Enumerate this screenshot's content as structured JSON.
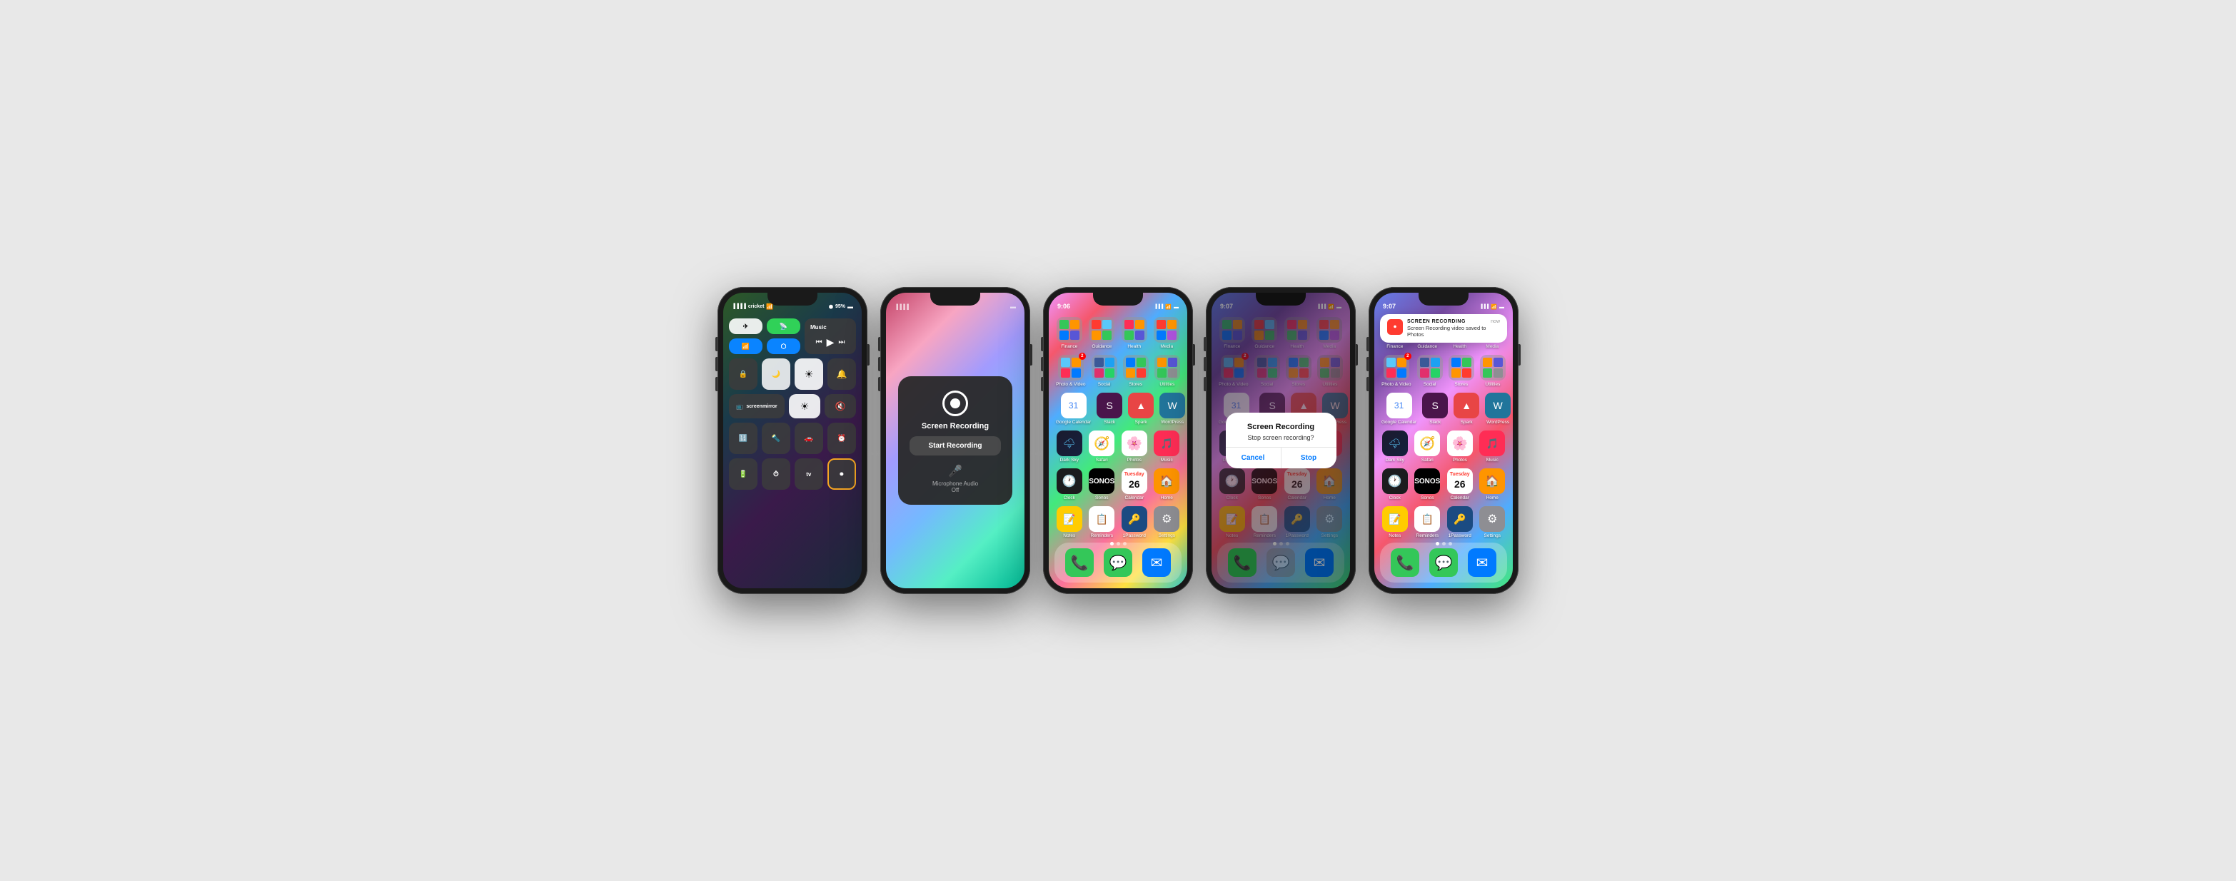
{
  "phones": [
    {
      "id": "phone1",
      "type": "control-center",
      "statusBar": {
        "time": "",
        "carrier": "cricket",
        "wifi": true,
        "battery": "95%",
        "bluetooth": true
      },
      "controlCenter": {
        "row1": [
          "airplane",
          "hotspot",
          "music_block"
        ],
        "row2": [
          "wifi",
          "bluetooth",
          "prev",
          "play",
          "next"
        ],
        "music": {
          "title": "Music"
        },
        "row3": [
          "rotation",
          "donotdisturb",
          "brightness",
          "volume"
        ],
        "row4": [
          "screenmirror",
          "brightness_slider"
        ],
        "row5": [
          "calc",
          "flashlight",
          "carplay",
          "alarm"
        ],
        "row6": [
          "battery",
          "timer",
          "appletv",
          "screenrecord"
        ]
      }
    },
    {
      "id": "phone2",
      "type": "screen-recording-popup",
      "statusBar": {
        "time": ""
      },
      "popup": {
        "title": "Screen Recording",
        "startBtn": "Start Recording",
        "micLabel": "Microphone Audio",
        "micStatus": "Off"
      }
    },
    {
      "id": "phone3",
      "type": "homescreen",
      "statusBar": {
        "time": "9:06",
        "recording": false
      },
      "apps": {
        "rows": [
          [
            "Finance",
            "Guidance",
            "Health",
            "Media"
          ],
          [
            "Photo & Video",
            "Social",
            "Stores",
            "Utilities"
          ],
          [
            "GoogleCalendar",
            "Slack",
            "Spark",
            "WordPress"
          ],
          [
            "DarkSky",
            "Safari",
            "Photos",
            "Music"
          ],
          [
            "Clock",
            "Sonos",
            "Calendar",
            "Home"
          ],
          [
            "Notes",
            "Reminders",
            "1Password",
            "Settings"
          ]
        ]
      },
      "dock": [
        "Phone",
        "Messages",
        "Mail"
      ]
    },
    {
      "id": "phone4",
      "type": "homescreen-dialog",
      "statusBar": {
        "time": "9:07",
        "recording": true
      },
      "dialog": {
        "title": "Screen Recording",
        "message": "Stop screen recording?",
        "cancelBtn": "Cancel",
        "stopBtn": "Stop"
      }
    },
    {
      "id": "phone5",
      "type": "homescreen-notification",
      "statusBar": {
        "time": "9:07",
        "recording": false
      },
      "notification": {
        "app": "Screen Recording",
        "time": "now",
        "message": "Screen Recording video saved to Photos"
      }
    }
  ]
}
